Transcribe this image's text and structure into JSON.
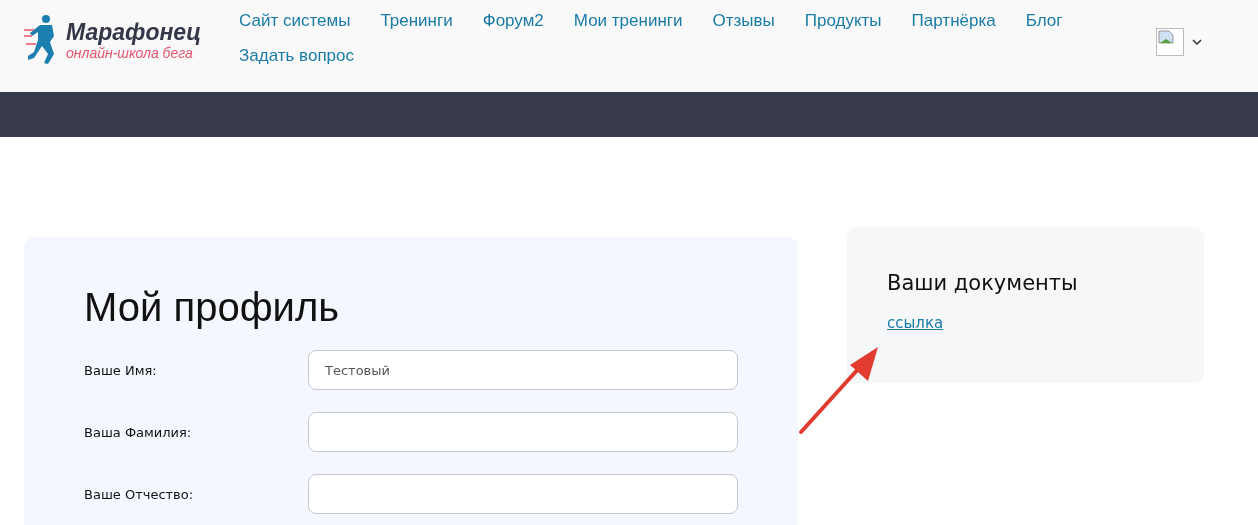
{
  "logo": {
    "title": "Марафонец",
    "subtitle": "онлайн-школа бега"
  },
  "nav": [
    "Сайт системы",
    "Тренинги",
    "Форум2",
    "Мои тренинги",
    "Отзывы",
    "Продукты",
    "Партнёрка",
    "Блог",
    "Задать вопрос"
  ],
  "profile": {
    "title": "Мой профиль",
    "fields": [
      {
        "label": "Ваше Имя:",
        "value": "Тестовый"
      },
      {
        "label": "Ваша Фамилия:"
      },
      {
        "label": "Ваше Отчество:"
      }
    ]
  },
  "documents": {
    "title": "Ваши документы",
    "link": "ссылка"
  }
}
